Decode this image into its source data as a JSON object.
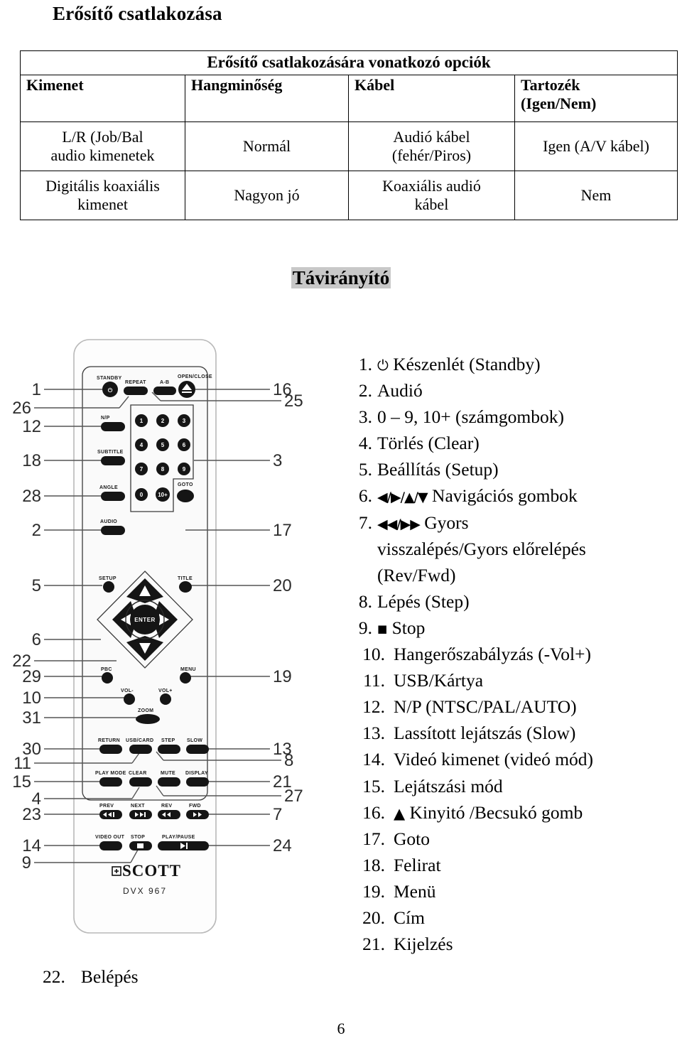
{
  "document": {
    "title": "Erősítő csatlakozása",
    "page_number": "6"
  },
  "options_table": {
    "span_header": "Erősítő csatlakozására vonatkozó opciók",
    "column_headers": [
      "Kimenet",
      "Hangminőség",
      "Kábel",
      "Tartozék\n(Igen/Nem)"
    ],
    "column_header_lines": [
      [
        "Kimenet"
      ],
      [
        "Hangminőség"
      ],
      [
        "Kábel"
      ],
      [
        "Tartozék",
        "(Igen/Nem)"
      ]
    ],
    "rows": [
      {
        "kimenet": "L/R (Job/Bal audio kimenetek",
        "kimenet_lines": [
          "L/R (Job/Bal",
          "audio kimenetek"
        ],
        "hangminoseg": "Normál",
        "kabel": "Audió kábel (fehér/Piros)",
        "kabel_lines": [
          "Audió kábel",
          "(fehér/Piros)"
        ],
        "tartozek": "Igen (A/V kábel)"
      },
      {
        "kimenet": "Digitális koaxiális kimenet",
        "kimenet_lines": [
          "Digitális koaxiális",
          "kimenet"
        ],
        "hangminoseg": "Nagyon jó",
        "kabel": "Koaxiális audió kábel",
        "kabel_lines": [
          "Koaxiális audió",
          "kábel"
        ],
        "tartozek": "Nem"
      }
    ]
  },
  "remote_section": {
    "heading": "Távirányító",
    "heading_highlight_color": "#c8c8c8",
    "diagram": {
      "brand": "SCOTT",
      "model": "DVX 967",
      "button_labels": [
        "STANDBY",
        "REPEAT",
        "A-B",
        "OPEN/CLOSE",
        "N/P",
        "SUBTITLE",
        "ANGLE",
        "AUDIO",
        "SETUP",
        "TITLE",
        "PBC",
        "MENU",
        "VOL-",
        "VOL+",
        "ZOOM",
        "GOTO",
        "RETURN",
        "USB/CARD",
        "STEP",
        "SLOW",
        "PLAY MODE",
        "CLEAR",
        "MUTE",
        "DISPLAY",
        "PREV",
        "NEXT",
        "REV",
        "FWD",
        "VIDEO OUT",
        "STOP",
        "PLAY/PAUSE",
        "ENTER"
      ],
      "keypad_digits": [
        "1",
        "2",
        "3",
        "4",
        "5",
        "6",
        "7",
        "8",
        "9",
        "0",
        "10+"
      ],
      "callouts_left": [
        "1",
        "26",
        "12",
        "18",
        "28",
        "2",
        "5",
        "6",
        "22",
        "29",
        "10",
        "31",
        "30",
        "11",
        "15",
        "4",
        "23",
        "14",
        "9"
      ],
      "callouts_right": [
        "16",
        "25",
        "3",
        "17",
        "20",
        "19",
        "13",
        "8",
        "21",
        "27",
        "7",
        "24"
      ]
    }
  },
  "legend": {
    "items": [
      {
        "num": "1.",
        "glyph": "power-icon",
        "text": "Készenlét (Standby)"
      },
      {
        "num": "2.",
        "glyph": "",
        "text": "Audió"
      },
      {
        "num": "3.",
        "glyph": "",
        "text": "0 – 9, 10+ (számgombok)"
      },
      {
        "num": "4.",
        "glyph": "",
        "text": "Törlés (Clear)"
      },
      {
        "num": "5.",
        "glyph": "",
        "text": "Beállítás (Setup)"
      },
      {
        "num": "6.",
        "glyph": "nav-arrows-icon",
        "text": "Navigációs gombok",
        "prefix": "◀/▶/▲/▼"
      },
      {
        "num": "7.",
        "glyph": "fast-arrows-icon",
        "text": "Gyors visszalépés/Gyors előrelépés (Rev/Fwd)",
        "prefix": "◀◀/▶▶",
        "lines": [
          "Gyors",
          "visszalépés/Gyors előrelépés",
          "(Rev/Fwd)"
        ]
      },
      {
        "num": "8.",
        "glyph": "",
        "text": "Lépés (Step)"
      },
      {
        "num": "9.",
        "glyph": "stop-square-icon",
        "text": "Stop",
        "prefix": "■"
      },
      {
        "num": "10.",
        "glyph": "",
        "text": "Hangerőszabályzás (-Vol+)"
      },
      {
        "num": "11.",
        "glyph": "",
        "text": "USB/Kártya"
      },
      {
        "num": "12.",
        "glyph": "",
        "text": "N/P (NTSC/PAL/AUTO)"
      },
      {
        "num": "13.",
        "glyph": "",
        "text": "Lassított lejátszás (Slow)"
      },
      {
        "num": "14.",
        "glyph": "",
        "text": "Videó kimenet (videó mód)"
      },
      {
        "num": "15.",
        "glyph": "",
        "text": "Lejátszási mód"
      },
      {
        "num": "16.",
        "glyph": "eject-triangle-icon",
        "text": "Kinyitó /Becsukó gomb",
        "prefix": "▲"
      },
      {
        "num": "17.",
        "glyph": "",
        "text": "Goto"
      },
      {
        "num": "18.",
        "glyph": "",
        "text": "Felirat"
      },
      {
        "num": "19.",
        "glyph": "",
        "text": "Menü"
      },
      {
        "num": "20.",
        "glyph": "",
        "text": "Cím"
      },
      {
        "num": "21.",
        "glyph": "",
        "text": "Kijelzés"
      }
    ],
    "item_22": {
      "num": "22.",
      "text": "Belépés"
    }
  }
}
